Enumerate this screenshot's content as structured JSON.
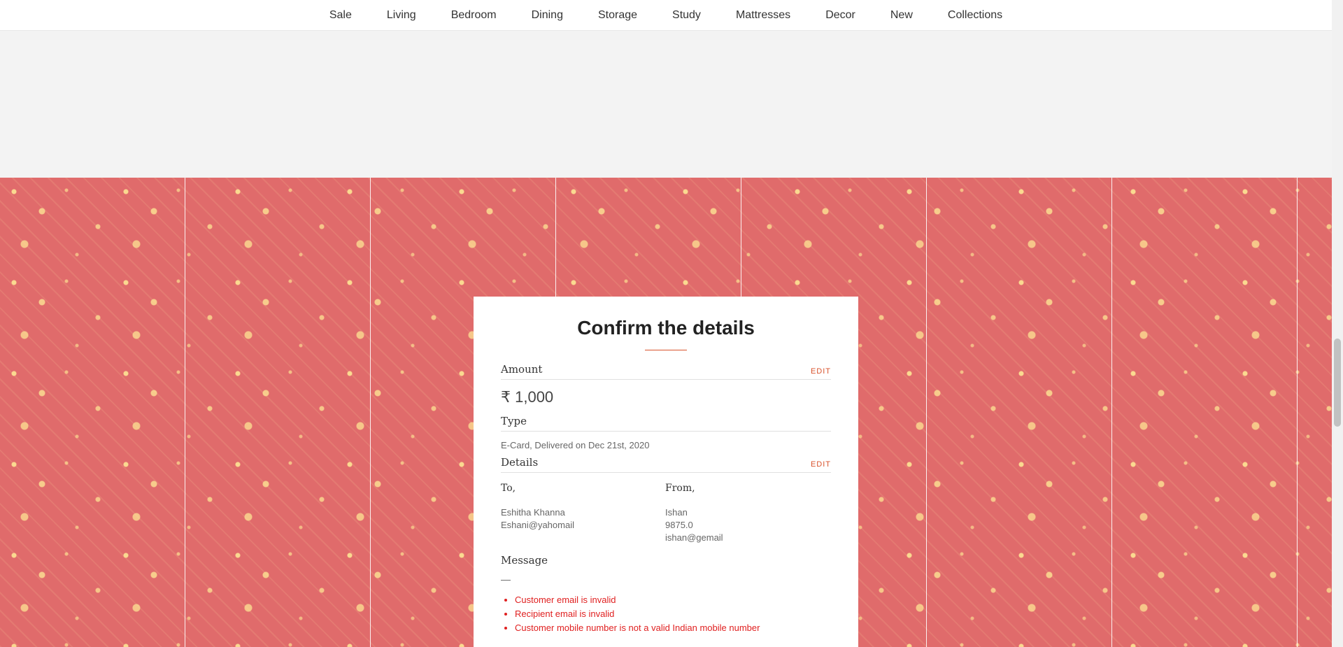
{
  "nav": {
    "items": [
      "Sale",
      "Living",
      "Bedroom",
      "Dining",
      "Storage",
      "Study",
      "Mattresses",
      "Decor",
      "New",
      "Collections"
    ]
  },
  "card": {
    "title": "Confirm the details",
    "amount": {
      "label": "Amount",
      "edit": "EDIT",
      "value": "₹ 1,000"
    },
    "type": {
      "label": "Type",
      "value": "E-Card, Delivered on Dec 21st, 2020"
    },
    "details": {
      "label": "Details",
      "edit": "EDIT",
      "to": {
        "label": "To,",
        "name": "Eshitha Khanna",
        "email": "Eshani@yahomail"
      },
      "from": {
        "label": "From,",
        "name": "Ishan",
        "phone": "9875.0",
        "email": "ishan@gemail"
      }
    },
    "message": {
      "label": "Message",
      "value": "—"
    },
    "errors": [
      "Customer email is invalid",
      "Recipient email is invalid",
      "Customer mobile number is not a valid Indian mobile number"
    ]
  },
  "colors": {
    "accent": "#d9532c",
    "pattern_bg": "#e06b6b",
    "error": "#e02020"
  }
}
